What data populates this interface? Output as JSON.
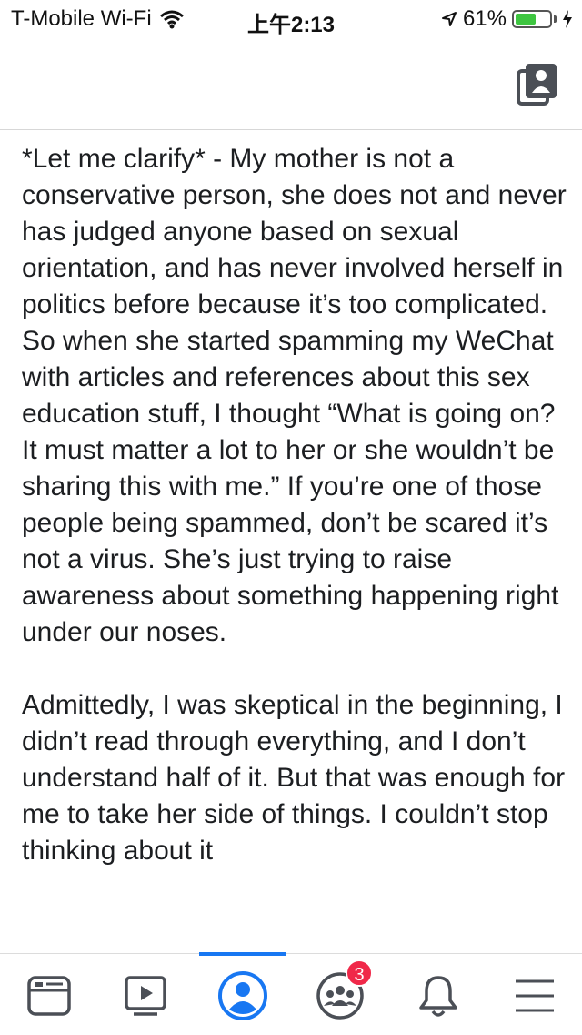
{
  "status_bar": {
    "carrier": "T-Mobile Wi-Fi",
    "time": "上午2:13",
    "battery_percent": "61%",
    "battery_level": 0.61,
    "battery_color": "#3ec540"
  },
  "nav": {
    "profile_icon": "profile-icon"
  },
  "post": {
    "paragraphs": [
      "*Let me clarify* - My mother is not a conservative person, she does not and never has judged anyone based on sexual orientation, and has never involved herself in politics before because it’s too complicated. So when she started spamming my WeChat with articles and references about this sex education stuff, I thought “What is going on? It must matter a lot to her or she wouldn’t be sharing this with me.” If you’re one of those people being spammed, don’t be scared it’s not a virus. She’s just trying to raise awareness about something happening right under our noses.",
      "Admittedly, I was skeptical in the beginning, I didn’t read through everything, and I don’t understand half of it. But that was enough for me to take her side of things. I couldn’t stop thinking about it"
    ]
  },
  "tab_bar": {
    "accent": "#1877f2",
    "tabs": [
      {
        "icon": "news-feed-icon"
      },
      {
        "icon": "watch-icon"
      },
      {
        "icon": "profile-icon",
        "active": true
      },
      {
        "icon": "groups-icon",
        "badge": "3"
      },
      {
        "icon": "bell-icon"
      },
      {
        "icon": "menu-icon"
      }
    ]
  }
}
